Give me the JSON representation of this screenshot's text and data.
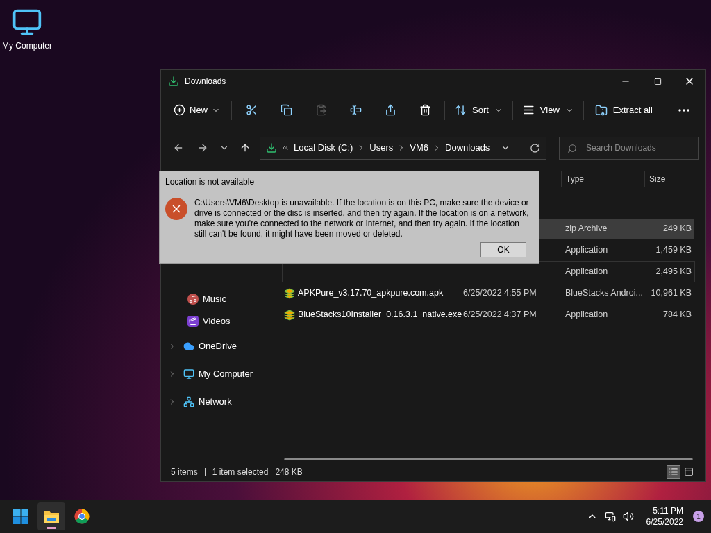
{
  "desktop_icons": [
    {
      "label": "My Computer"
    }
  ],
  "window": {
    "title": "Downloads"
  },
  "toolbar": {
    "new": "New",
    "sort": "Sort",
    "view": "View",
    "extract": "Extract all"
  },
  "address": {
    "path": [
      "Local Disk (C:)",
      "Users",
      "VM6",
      "Downloads"
    ],
    "search_placeholder": "Search Downloads"
  },
  "sidebar": [
    {
      "label": "Music",
      "kind": "music"
    },
    {
      "label": "Videos",
      "kind": "videos"
    },
    {
      "label": "OneDrive",
      "kind": "cloud"
    },
    {
      "label": "My Computer",
      "kind": "computer"
    },
    {
      "label": "Network",
      "kind": "network"
    }
  ],
  "columns": {
    "type": "Type",
    "size": "Size"
  },
  "rows": [
    {
      "type": "zip Archive",
      "size": "249 KB",
      "selected": true,
      "hovered": false
    },
    {
      "type": "Application",
      "size": "1,459 KB",
      "selected": false,
      "hovered": false
    },
    {
      "type": "Application",
      "size": "2,495 KB",
      "selected": false,
      "hovered": true
    },
    {
      "name": "APKPure_v3.17.70_apkpure.com.apk",
      "date": "6/25/2022 4:55 PM",
      "type": "BlueStacks Androi...",
      "size": "10,961 KB",
      "selected": false,
      "hovered": false
    },
    {
      "name": "BlueStacks10Installer_0.16.3.1_native.exe",
      "date": "6/25/2022 4:37 PM",
      "type": "Application",
      "size": "784 KB",
      "selected": false,
      "hovered": false
    }
  ],
  "status_bar": {
    "count": "5 items",
    "selection": "1 item selected",
    "size": "248 KB",
    "views": [
      {
        "kind": "details",
        "selected": true
      },
      {
        "kind": "tiles",
        "selected": false
      }
    ]
  },
  "dialog": {
    "title": "Location is not available",
    "message": "C:\\Users\\VM6\\Desktop is unavailable. If the location is on this PC, make sure the device or drive is connected or the disc is inserted, and then try again. If the location is on a network, make sure you're connected to the network or Internet, and then try again. If the location still can't be found, it might have been moved or deleted.",
    "ok": "OK"
  },
  "taskbar": {
    "apps": [
      {
        "kind": "start",
        "active": false
      },
      {
        "kind": "explorer",
        "active": true
      },
      {
        "kind": "chrome",
        "active": false
      }
    ],
    "time": "5:11 PM",
    "date": "6/25/2022",
    "notifications": "1"
  }
}
